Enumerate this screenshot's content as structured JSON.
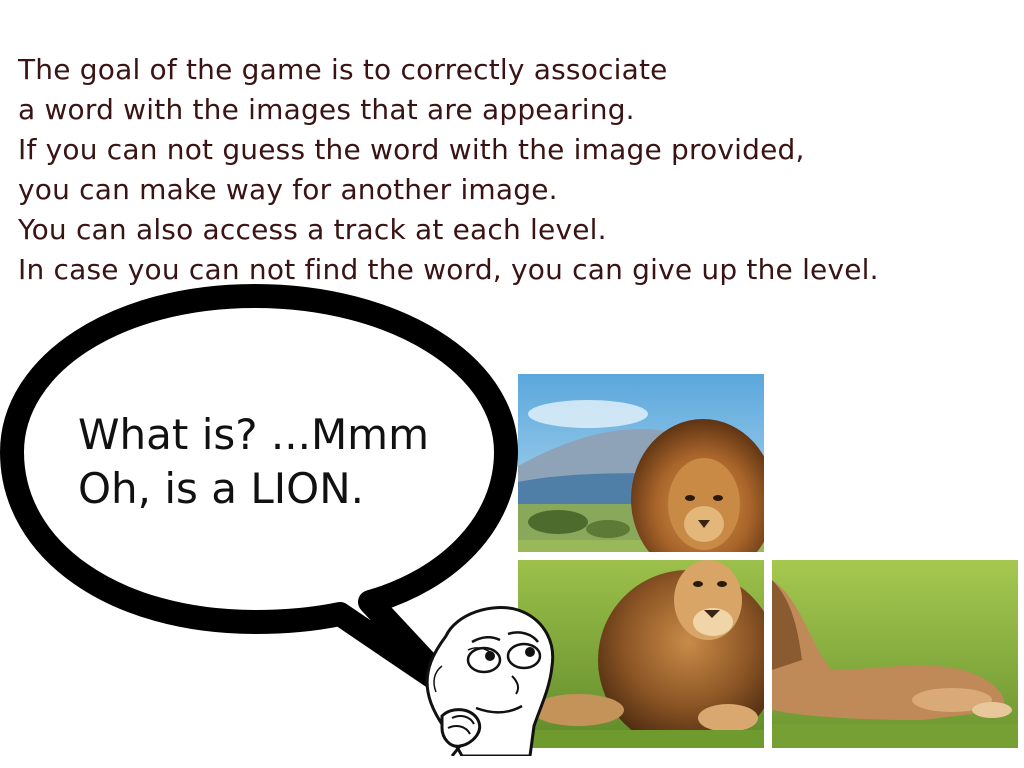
{
  "instructions": {
    "lines": [
      "The goal of the game is to correctly associate",
      "a word with the images that are appearing.",
      "If you can not guess the word with the image provided,",
      "you can make way for another image.",
      "You can also access a track at each level.",
      "In case you can not find the word, you can give up the level."
    ]
  },
  "speech_bubble": {
    "lines": [
      "What is? ...Mmm",
      "Oh, is a LION."
    ]
  },
  "image_tiles": {
    "count": 3,
    "subject": "lion"
  },
  "colors": {
    "instruction_text": "#3a1414",
    "bubble_text": "#111111",
    "bubble_outline": "#000000",
    "background": "#ffffff"
  },
  "icons": {
    "thinking_face": "thinking-face-icon"
  }
}
